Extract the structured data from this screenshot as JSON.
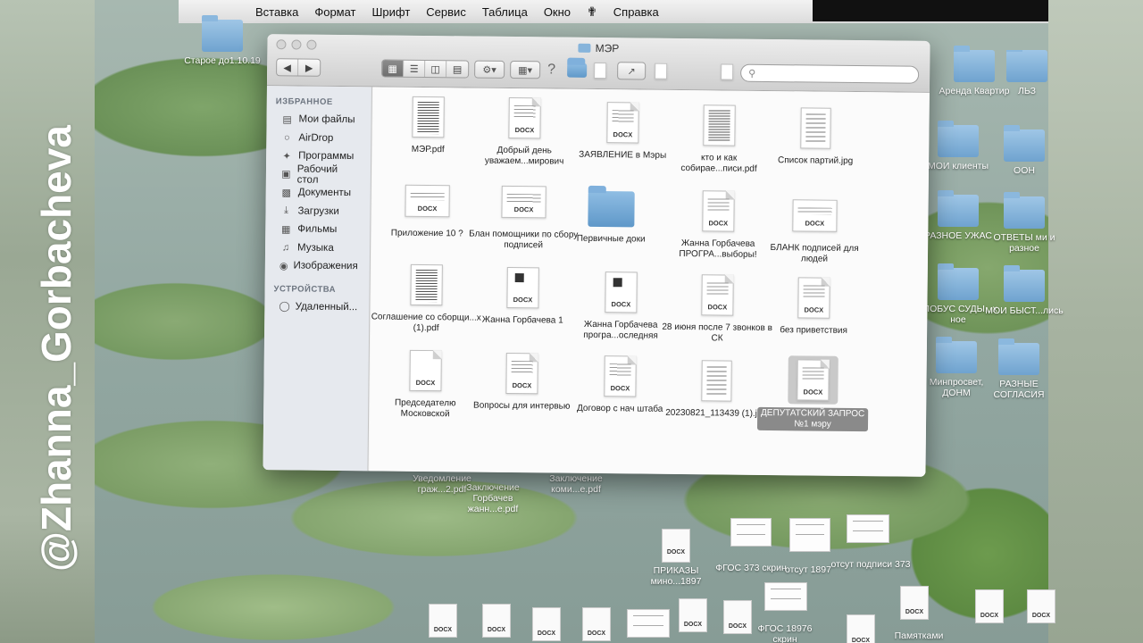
{
  "watermark": "@Zhanna_Gorbacheva",
  "menubar": {
    "apple_glyph": "",
    "items": [
      "Вставка",
      "Формат",
      "Шрифт",
      "Сервис",
      "Таблица",
      "Окно",
      "Справка"
    ]
  },
  "finder": {
    "title": "МЭР",
    "search_placeholder": "",
    "sidebar": {
      "favorites_header": "ИЗБРАННОЕ",
      "favorites": [
        {
          "label": "Мои файлы",
          "icon": "all-my-files-icon"
        },
        {
          "label": "AirDrop",
          "icon": "airdrop-icon"
        },
        {
          "label": "Программы",
          "icon": "applications-icon"
        },
        {
          "label": "Рабочий стол",
          "icon": "desktop-icon"
        },
        {
          "label": "Документы",
          "icon": "documents-icon"
        },
        {
          "label": "Загрузки",
          "icon": "downloads-icon"
        },
        {
          "label": "Фильмы",
          "icon": "movies-icon"
        },
        {
          "label": "Музыка",
          "icon": "music-icon"
        },
        {
          "label": "Изображения",
          "icon": "pictures-icon"
        }
      ],
      "devices_header": "УСТРОЙСТВА",
      "devices": [
        {
          "label": "Удаленный...",
          "icon": "remote-disc-icon"
        }
      ]
    },
    "files": [
      {
        "label": "МЭР.pdf",
        "kind": "pdf"
      },
      {
        "label": "Добрый день уважаем...мирович",
        "kind": "docx"
      },
      {
        "label": "ЗАЯВЛЕНИЕ в Мэры",
        "kind": "docx"
      },
      {
        "label": "кто и как собирае...писи.pdf",
        "kind": "pdf"
      },
      {
        "label": "Список партий.jpg",
        "kind": "jpg"
      },
      {
        "label": "Приложение 10 ?",
        "kind": "docx-wide"
      },
      {
        "label": "Блан помощники по сбору подписей",
        "kind": "docx-wide"
      },
      {
        "label": "Первичные доки",
        "kind": "folder"
      },
      {
        "label": "Жанна Горбачева ПРОГРА...выборы!",
        "kind": "docx"
      },
      {
        "label": "БЛАНК подписей для людей",
        "kind": "docx-wide"
      },
      {
        "label": "Соглашение со сборщи...х (1).pdf",
        "kind": "pdf"
      },
      {
        "label": "Жанна Горбачева 1",
        "kind": "docx-mark"
      },
      {
        "label": "Жанна Горбачева програ...оследняя",
        "kind": "docx-mark"
      },
      {
        "label": "28 июня после 7 звонков в СК",
        "kind": "docx"
      },
      {
        "label": "без приветствия",
        "kind": "docx"
      },
      {
        "label": "Председателю Московской",
        "kind": "docx"
      },
      {
        "label": "Вопросы для интервью",
        "kind": "docx"
      },
      {
        "label": "Договор с нач штаба",
        "kind": "docx"
      },
      {
        "label": "20230821_113439 (1).jpg",
        "kind": "jpg"
      },
      {
        "label": "ДЕПУТАТСКИЙ ЗАПРОС №1 мэру",
        "kind": "docx",
        "selected": true
      }
    ],
    "doc_tag": "DOCX"
  },
  "desktop_icons": [
    {
      "label": "Старое до1.10.19",
      "kind": "folder"
    },
    {
      "label": "Аренда Квартир",
      "kind": "folder"
    },
    {
      "label": "МОИ клиенты",
      "kind": "folder"
    },
    {
      "label": "ООН",
      "kind": "folder"
    },
    {
      "label": "РАЗНОЕ УЖАС",
      "kind": "folder"
    },
    {
      "label": "ОТВЕТЫ ми и разное",
      "kind": "folder"
    },
    {
      "label": "ГЛОБУС СУДЫ...х ное",
      "kind": "folder"
    },
    {
      "label": "МОИ БЫСТ...лись",
      "kind": "folder"
    },
    {
      "label": "Минпросвет, ДОНМ",
      "kind": "folder"
    },
    {
      "label": "РАЗНЫЕ СОГЛАСИЯ",
      "kind": "folder"
    },
    {
      "label": "ЛЬЗ",
      "kind": "folder"
    },
    {
      "label": "Уведомление граж...2.pdf",
      "kind": "text"
    },
    {
      "label": "Заключение Горбачев жанн...е.pdf",
      "kind": "text"
    },
    {
      "label": "Заключение коми...е.pdf",
      "kind": "text"
    },
    {
      "label": "ПРИКАЗЫ мино...1897",
      "kind": "docx"
    },
    {
      "label": "ФГОС 373 скрин",
      "kind": "thumb"
    },
    {
      "label": "отсут 1897",
      "kind": "thumb"
    },
    {
      "label": "отсут подписи 373",
      "kind": "thumb"
    },
    {
      "label": "ФГОС 18976 скрин",
      "kind": "thumb"
    },
    {
      "label": "Памятками",
      "kind": "text"
    }
  ]
}
